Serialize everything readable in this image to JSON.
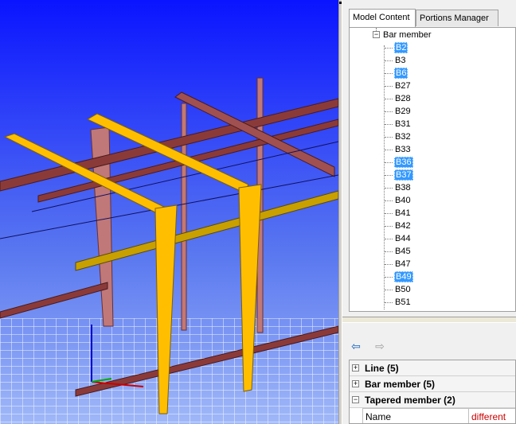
{
  "tabs": [
    {
      "label": "Model Content",
      "active": true
    },
    {
      "label": "Portions Manager",
      "active": false
    }
  ],
  "tree": {
    "root_label": "Bar member",
    "items": [
      {
        "label": "B2",
        "selected": true
      },
      {
        "label": "B3",
        "selected": false
      },
      {
        "label": "B6",
        "selected": true
      },
      {
        "label": "B27",
        "selected": false
      },
      {
        "label": "B28",
        "selected": false
      },
      {
        "label": "B29",
        "selected": false
      },
      {
        "label": "B31",
        "selected": false
      },
      {
        "label": "B32",
        "selected": false
      },
      {
        "label": "B33",
        "selected": false
      },
      {
        "label": "B36",
        "selected": true
      },
      {
        "label": "B37",
        "selected": true
      },
      {
        "label": "B38",
        "selected": false
      },
      {
        "label": "B40",
        "selected": false
      },
      {
        "label": "B41",
        "selected": false
      },
      {
        "label": "B42",
        "selected": false
      },
      {
        "label": "B44",
        "selected": false
      },
      {
        "label": "B45",
        "selected": false
      },
      {
        "label": "B47",
        "selected": false
      },
      {
        "label": "B49",
        "selected": true
      },
      {
        "label": "B50",
        "selected": false
      },
      {
        "label": "B51",
        "selected": false
      }
    ]
  },
  "nav": {
    "back_icon": "back-arrow-icon",
    "forward_icon": "forward-arrow-icon"
  },
  "properties": {
    "groups": [
      {
        "label": "Line (5)",
        "expanded": false
      },
      {
        "label": "Bar member (5)",
        "expanded": false
      },
      {
        "label": "Tapered member (2)",
        "expanded": true
      }
    ],
    "row": {
      "name": "Name",
      "value": "different"
    }
  },
  "colors": {
    "viewport_top": "#0000ff",
    "viewport_bottom": "#8da8f5",
    "tapered_member": "#ffbf00",
    "bar_member": "#8b3a3a",
    "column_member": "#c87878",
    "selection": "#3399ff",
    "value_different": "#cc0000"
  }
}
